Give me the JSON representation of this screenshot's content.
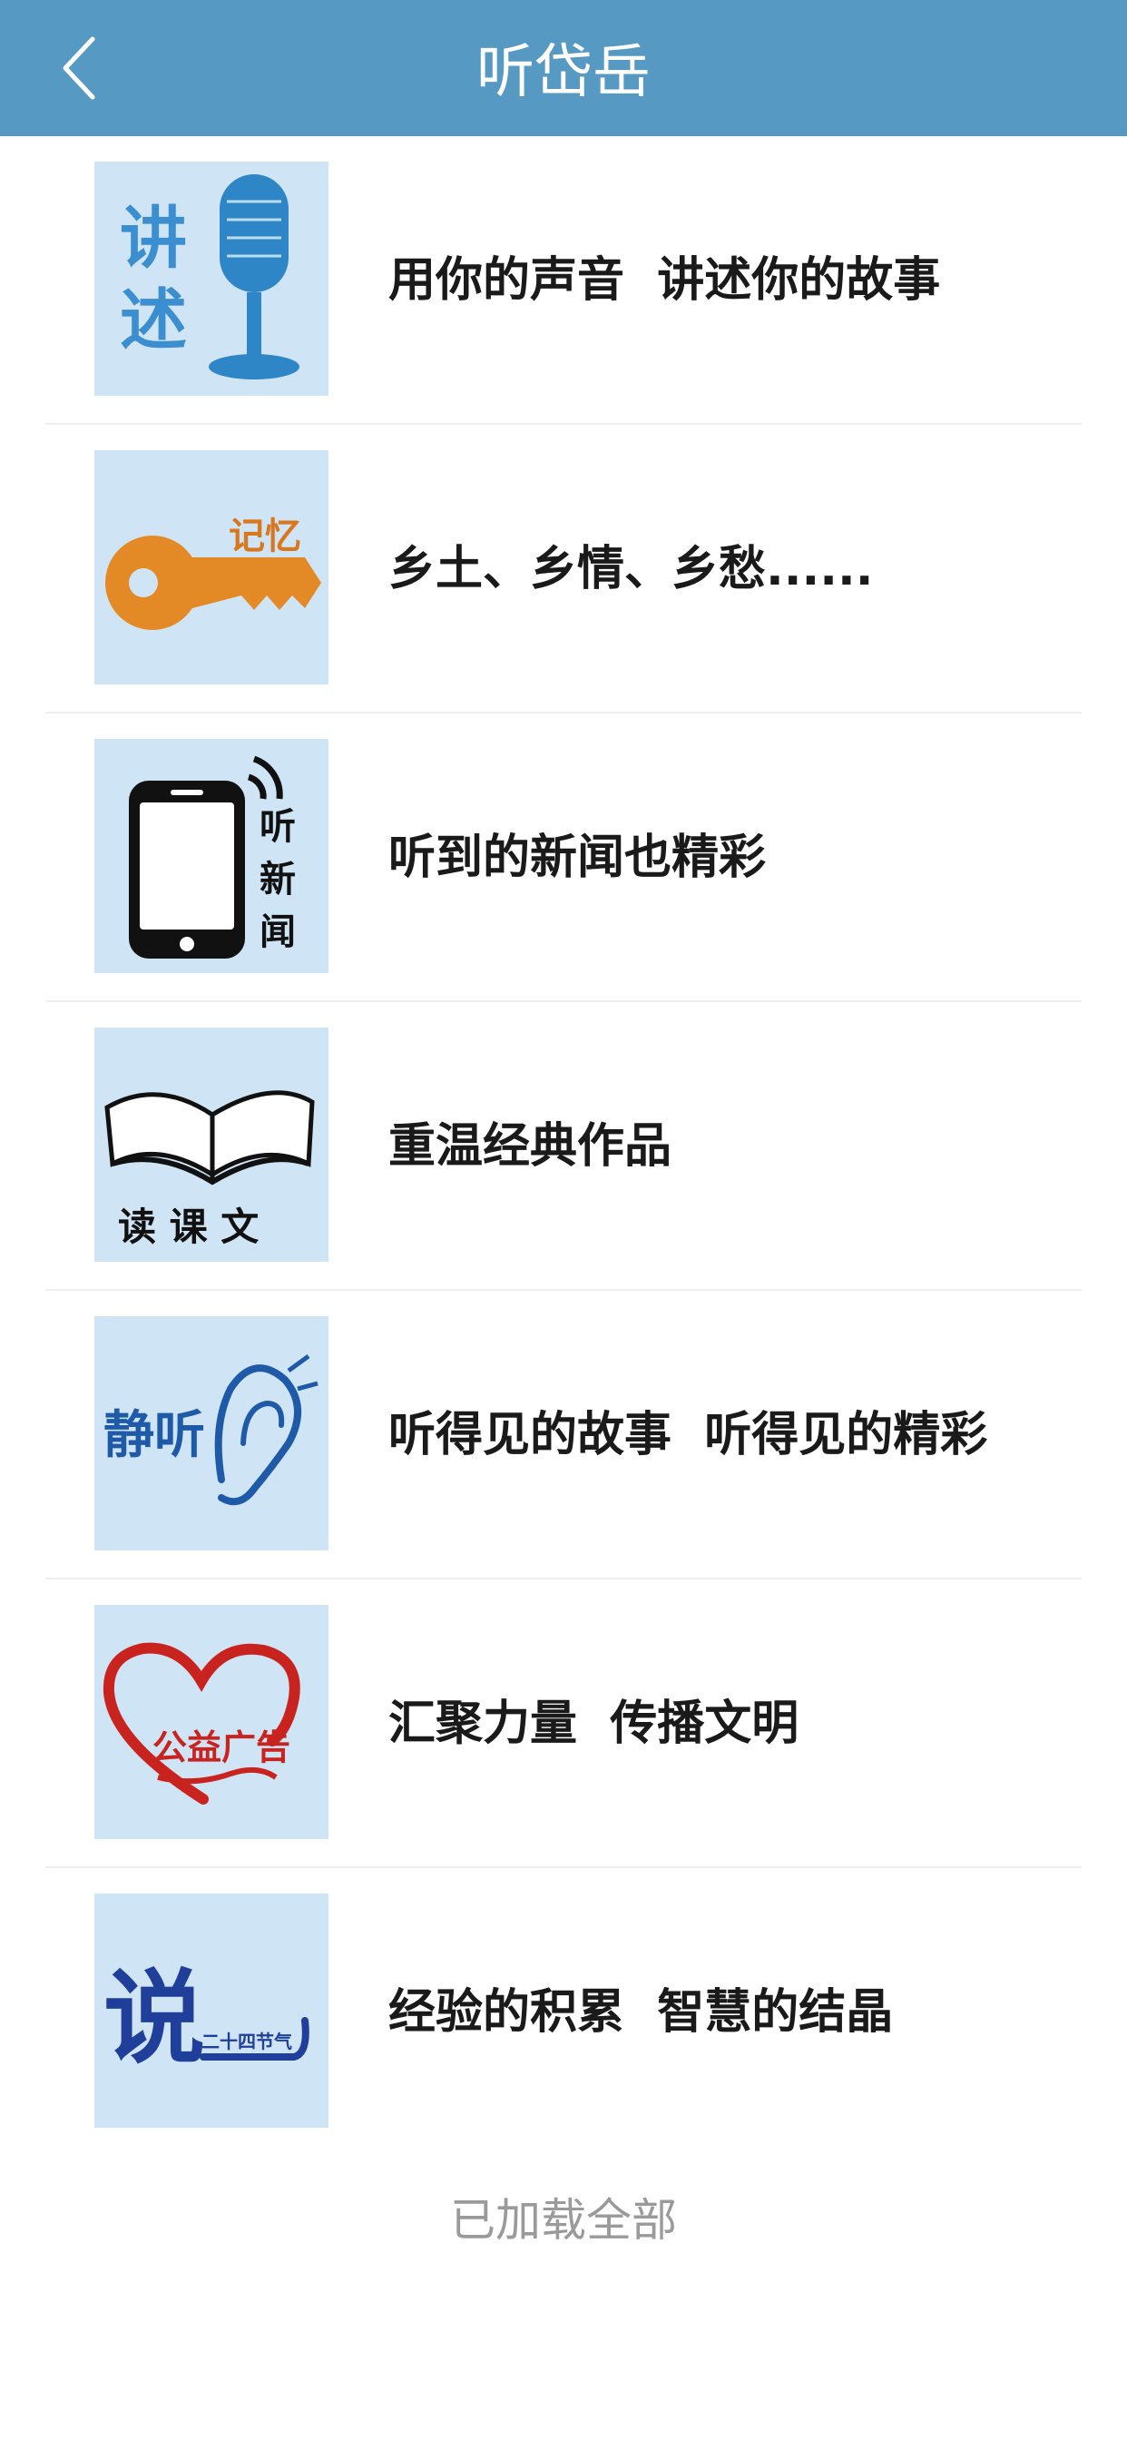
{
  "header": {
    "title": "听岱岳",
    "back_icon": "chevron-left-icon"
  },
  "items": [
    {
      "id": "jiangshu",
      "thumb_text": [
        "讲",
        "述"
      ],
      "thumb_icon": "microphone-icon",
      "caption": "用你的声音  讲述你的故事"
    },
    {
      "id": "jiyi",
      "thumb_text": "记忆",
      "thumb_icon": "key-icon",
      "caption": "乡土、乡情、乡愁......"
    },
    {
      "id": "tingxinwen",
      "thumb_text": [
        "听",
        "新",
        "闻"
      ],
      "thumb_icon": "smartphone-icon",
      "caption": "听到的新闻也精彩"
    },
    {
      "id": "dukewen",
      "thumb_text": "读 课 文",
      "thumb_icon": "open-book-icon",
      "caption": "重温经典作品"
    },
    {
      "id": "jingting",
      "thumb_text": "静听",
      "thumb_icon": "ear-icon",
      "caption": "听得见的故事  听得见的精彩"
    },
    {
      "id": "gongyi",
      "thumb_text": "公益广告",
      "thumb_icon": "heart-icon",
      "caption": "汇聚力量  传播文明"
    },
    {
      "id": "shuo",
      "thumb_text": [
        "说",
        "二十四节气"
      ],
      "thumb_icon": "shuo-calligraphy-icon",
      "caption": "经验的积累  智慧的结晶"
    }
  ],
  "footer": {
    "status": "已加载全部"
  },
  "colors": {
    "header_bg": "#5699c3",
    "thumb_bg": "#cfe4f5",
    "text": "#1a1a1a",
    "footer_text": "#9a9a9a"
  }
}
